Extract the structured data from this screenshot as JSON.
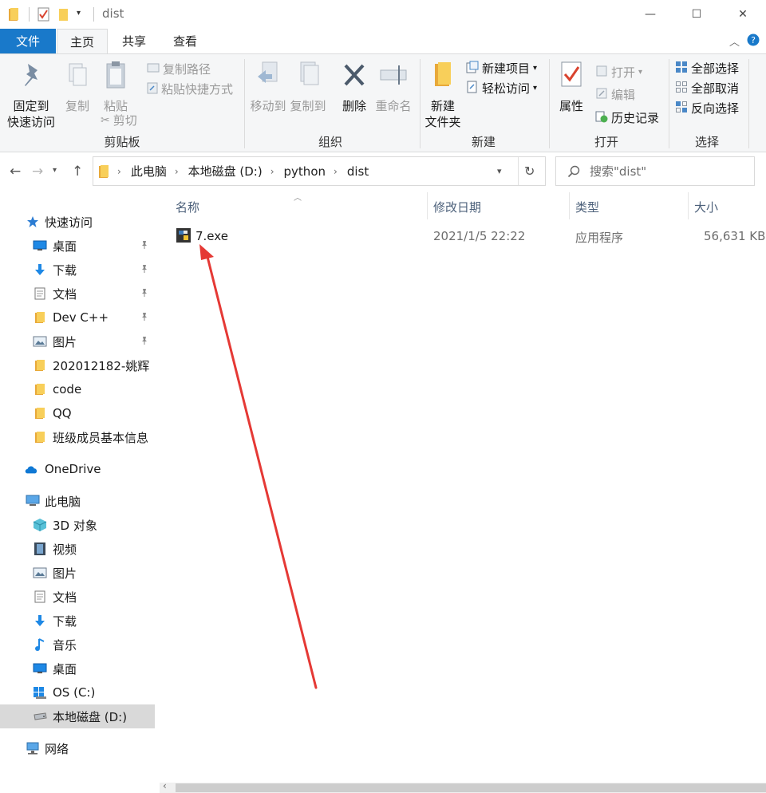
{
  "window": {
    "title": "dist",
    "controls": {
      "minimize": "—",
      "maximize": "☐",
      "close": "✕"
    }
  },
  "ribbon_tabs": [
    {
      "label": "文件"
    },
    {
      "label": "主页"
    },
    {
      "label": "共享"
    },
    {
      "label": "查看"
    }
  ],
  "ribbon": {
    "clipboard": {
      "pin_quick_access": "固定到\n快速访问",
      "copy": "复制",
      "paste": "粘贴",
      "copy_path": "复制路径",
      "paste_shortcut": "粘贴快捷方式",
      "cut": "剪切",
      "group_label": "剪贴板"
    },
    "organize": {
      "move_to": "移动到",
      "copy_to": "复制到",
      "delete": "删除",
      "rename": "重命名",
      "group_label": "组织"
    },
    "new": {
      "new_folder": "新建\n文件夹",
      "new_item": "新建项目",
      "easy_access": "轻松访问",
      "group_label": "新建"
    },
    "open": {
      "properties": "属性",
      "open": "打开",
      "edit": "编辑",
      "history": "历史记录",
      "group_label": "打开"
    },
    "select": {
      "select_all": "全部选择",
      "select_none": "全部取消",
      "invert": "反向选择",
      "group_label": "选择"
    }
  },
  "address": {
    "crumbs": [
      "此电脑",
      "本地磁盘 (D:)",
      "python",
      "dist"
    ],
    "search_placeholder": "搜索\"dist\""
  },
  "nav_pane": {
    "quick_access": "快速访问",
    "items": [
      {
        "label": "桌面",
        "icon": "desktop-icon",
        "pinned": true
      },
      {
        "label": "下载",
        "icon": "download-icon",
        "pinned": true
      },
      {
        "label": "文档",
        "icon": "document-icon",
        "pinned": true
      },
      {
        "label": "Dev C++",
        "icon": "folder-icon",
        "pinned": true
      },
      {
        "label": "图片",
        "icon": "picture-icon",
        "pinned": true
      },
      {
        "label": "202012182-姚辉",
        "icon": "folder-icon",
        "pinned": false
      },
      {
        "label": "code",
        "icon": "folder-icon",
        "pinned": false
      },
      {
        "label": "QQ",
        "icon": "folder-icon",
        "pinned": false
      },
      {
        "label": "班级成员基本信息",
        "icon": "folder-icon",
        "pinned": false
      }
    ],
    "onedrive": "OneDrive",
    "this_pc": "此电脑",
    "pc_items": [
      {
        "label": "3D 对象",
        "icon": "3d-objects-icon"
      },
      {
        "label": "视频",
        "icon": "video-icon"
      },
      {
        "label": "图片",
        "icon": "picture-icon"
      },
      {
        "label": "文档",
        "icon": "document-icon"
      },
      {
        "label": "下载",
        "icon": "download-icon"
      },
      {
        "label": "音乐",
        "icon": "music-icon"
      },
      {
        "label": "桌面",
        "icon": "desktop-icon"
      },
      {
        "label": "OS (C:)",
        "icon": "os-drive-icon"
      },
      {
        "label": "本地磁盘 (D:)",
        "icon": "drive-icon",
        "selected": true
      }
    ],
    "network": "网络"
  },
  "file_list": {
    "columns": [
      "名称",
      "修改日期",
      "类型",
      "大小"
    ],
    "rows": [
      {
        "name": "7.exe",
        "modified": "2021/1/5 22:22",
        "type": "应用程序",
        "size": "56,631 KB"
      }
    ]
  },
  "colors": {
    "accent": "#1979ca",
    "annotation_arrow": "#e53935",
    "selected_nav": "#d9d9d9"
  }
}
